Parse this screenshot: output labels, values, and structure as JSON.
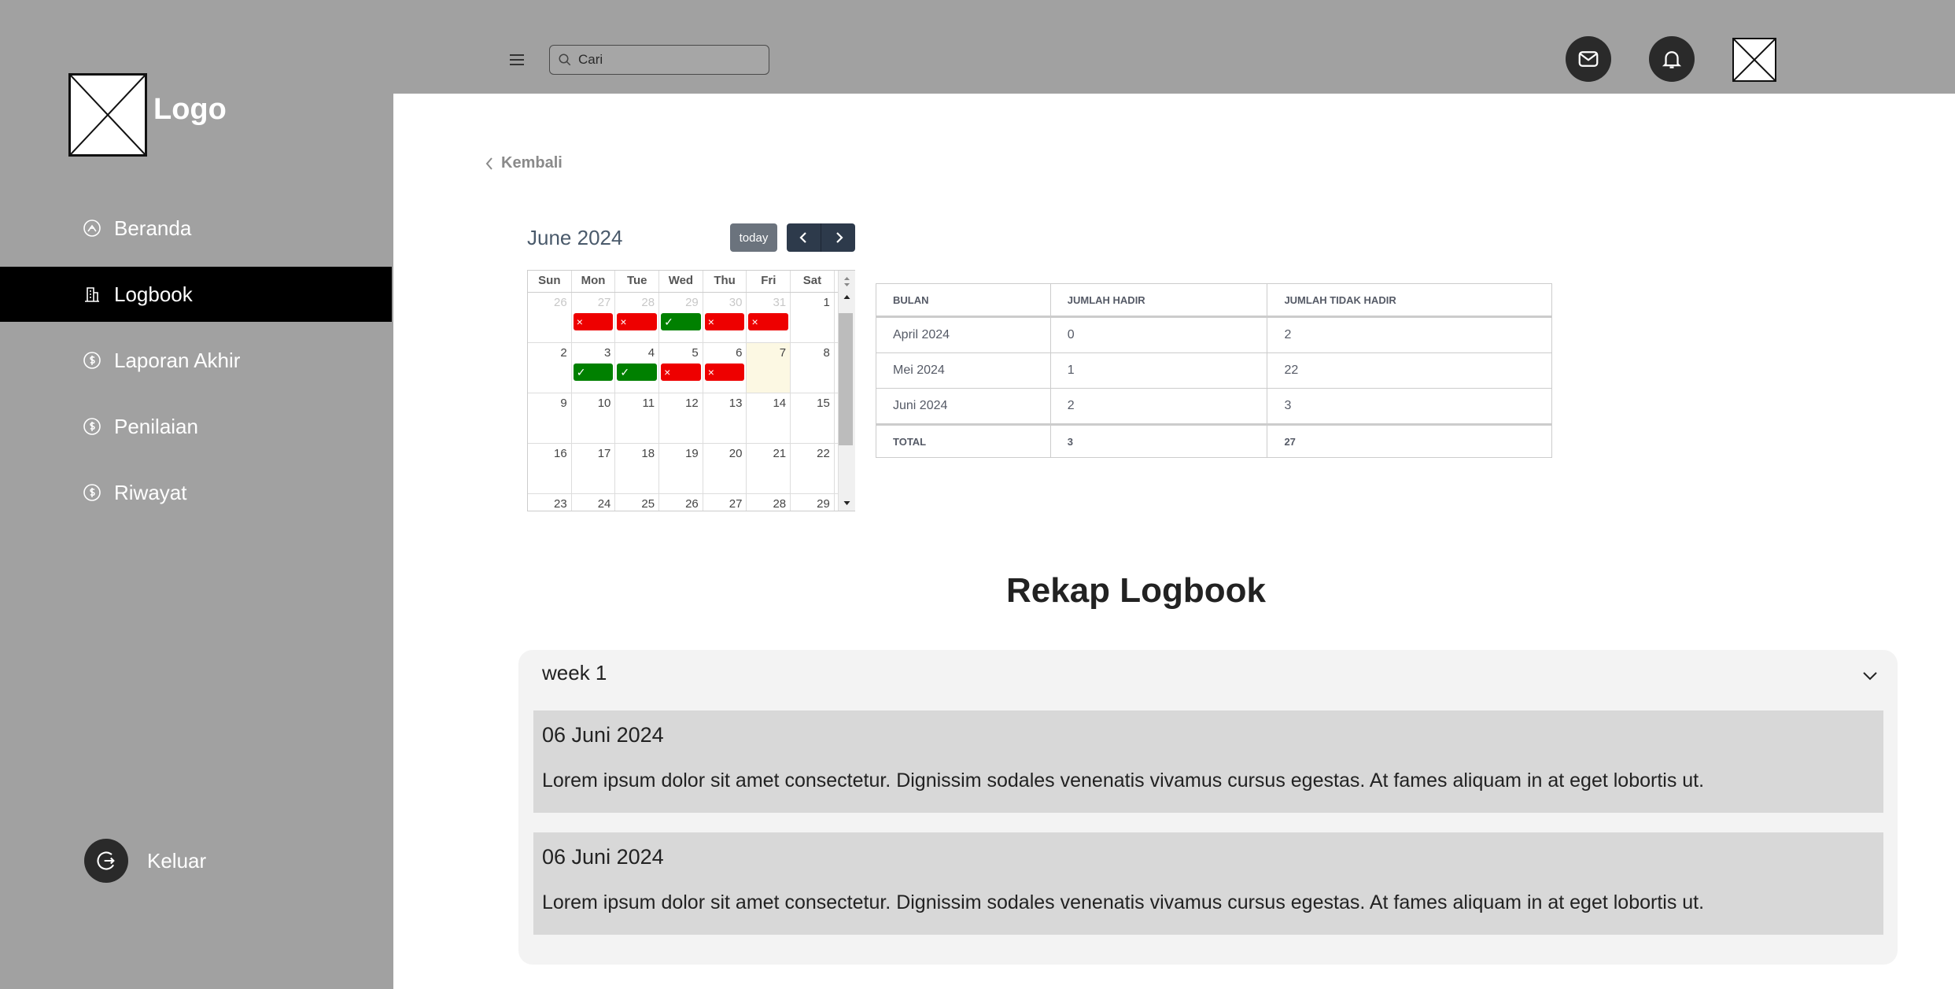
{
  "app": {
    "logo_text": "Logo",
    "colors": {
      "sidebar": "#a1a1a1",
      "active": "#000000",
      "event_absent": "#e00000",
      "event_present": "#008000",
      "today_bg": "#fcf8e3"
    }
  },
  "sidebar": {
    "items": [
      {
        "label": "Beranda",
        "icon": "home-circle-icon",
        "active": false
      },
      {
        "label": "Logbook",
        "icon": "building-icon",
        "active": true
      },
      {
        "label": "Laporan Akhir",
        "icon": "dollar-circle-icon",
        "active": false
      },
      {
        "label": "Penilaian",
        "icon": "dollar-circle-icon",
        "active": false
      },
      {
        "label": "Riwayat",
        "icon": "dollar-circle-icon",
        "active": false
      }
    ],
    "logout_label": "Keluar"
  },
  "topbar": {
    "search_value": "Cari",
    "icons": [
      "menu-icon",
      "mail-icon",
      "bell-icon",
      "avatar"
    ]
  },
  "main": {
    "back_label": "Kembali",
    "calendar": {
      "title": "June 2024",
      "today_label": "today",
      "weekdays": [
        "Sun",
        "Mon",
        "Tue",
        "Wed",
        "Thu",
        "Fri",
        "Sat"
      ],
      "weeks": [
        [
          {
            "d": "26",
            "o": true
          },
          {
            "d": "27",
            "o": true,
            "e": "absent"
          },
          {
            "d": "28",
            "o": true,
            "e": "absent"
          },
          {
            "d": "29",
            "o": true,
            "e": "present"
          },
          {
            "d": "30",
            "o": true,
            "e": "absent"
          },
          {
            "d": "31",
            "o": true,
            "e": "absent"
          },
          {
            "d": "1"
          }
        ],
        [
          {
            "d": "2"
          },
          {
            "d": "3",
            "e": "present"
          },
          {
            "d": "4",
            "e": "present"
          },
          {
            "d": "5",
            "e": "absent"
          },
          {
            "d": "6",
            "e": "absent"
          },
          {
            "d": "7",
            "today": true
          },
          {
            "d": "8"
          }
        ],
        [
          {
            "d": "9"
          },
          {
            "d": "10"
          },
          {
            "d": "11"
          },
          {
            "d": "12"
          },
          {
            "d": "13"
          },
          {
            "d": "14"
          },
          {
            "d": "15"
          }
        ],
        [
          {
            "d": "16"
          },
          {
            "d": "17"
          },
          {
            "d": "18"
          },
          {
            "d": "19"
          },
          {
            "d": "20"
          },
          {
            "d": "21"
          },
          {
            "d": "22"
          }
        ],
        [
          {
            "d": "23"
          },
          {
            "d": "24"
          },
          {
            "d": "25"
          },
          {
            "d": "26"
          },
          {
            "d": "27"
          },
          {
            "d": "28"
          },
          {
            "d": "29"
          }
        ]
      ],
      "event_marks": {
        "absent": "×",
        "present": "✓"
      }
    },
    "attendance": {
      "headers": [
        "BULAN",
        "JUMLAH HADIR",
        "JUMLAH TIDAK HADIR"
      ],
      "rows": [
        [
          "April 2024",
          "0",
          "2"
        ],
        [
          "Mei 2024",
          "1",
          "22"
        ],
        [
          "Juni 2024",
          "2",
          "3"
        ]
      ],
      "total": [
        "TOTAL",
        "3",
        "27"
      ]
    },
    "rekap": {
      "title": "Rekap Logbook",
      "week_label": "week 1",
      "entries": [
        {
          "date": "06 Juni 2024",
          "text": "Lorem ipsum dolor sit amet consectetur. Dignissim sodales venenatis vivamus cursus egestas. At fames aliquam in at eget lobortis ut."
        },
        {
          "date": "06 Juni 2024",
          "text": "Lorem ipsum dolor sit amet consectetur. Dignissim sodales venenatis vivamus cursus egestas. At fames aliquam in at eget lobortis ut."
        }
      ]
    }
  }
}
